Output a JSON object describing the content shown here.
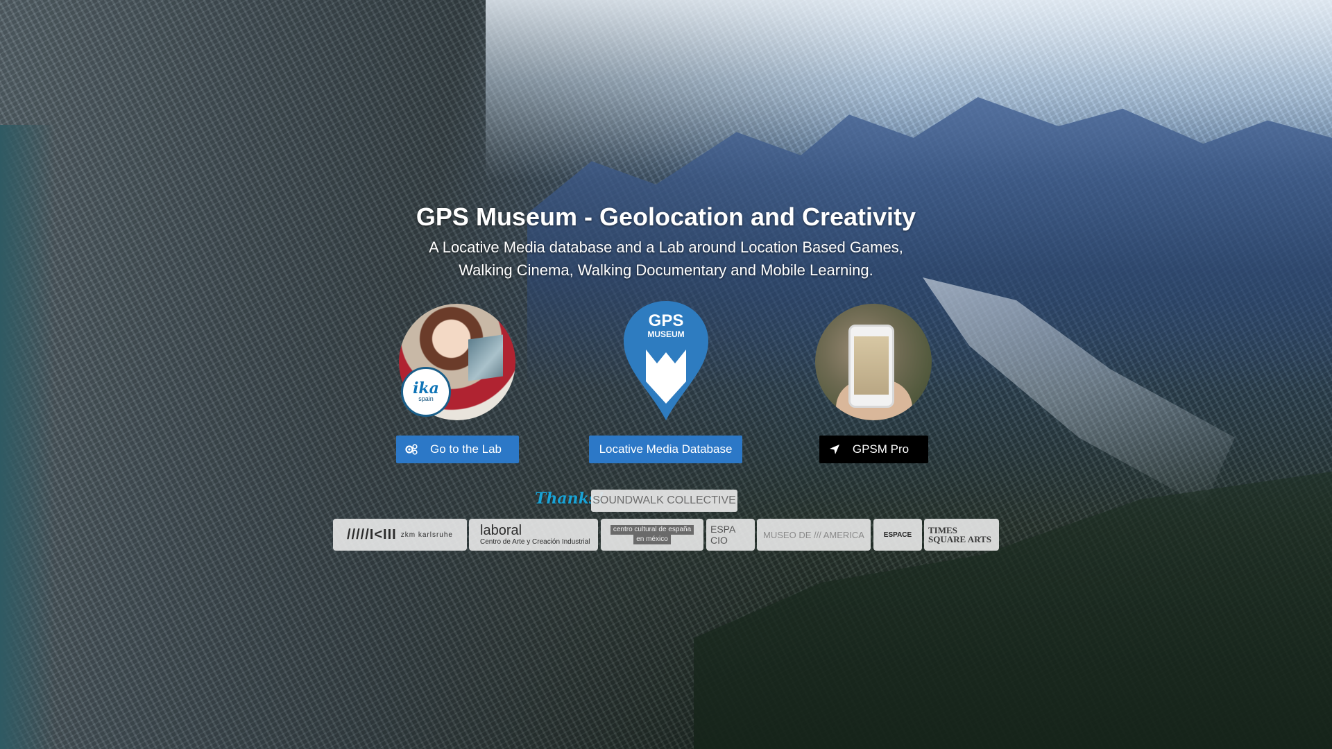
{
  "hero": {
    "title": "GPS Museum - Geolocation and Creativity",
    "subtitle_line1": "A Locative Media database and a Lab around Location Based Games,",
    "subtitle_line2": "Walking Cinema, Walking Documentary and Mobile Learning."
  },
  "cards": {
    "lab": {
      "badge_word": "ika",
      "badge_sub": "spain",
      "button_label": "Go to the Lab",
      "button_icon": "gears-icon"
    },
    "database": {
      "logo_text_line1": "GPS",
      "logo_text_line2": "MUSEUM",
      "button_label": "Locative Media Database"
    },
    "pro": {
      "button_label": "GPSM Pro",
      "button_icon": "location-arrow-icon"
    }
  },
  "partners": {
    "thanks_label": "Thanks!",
    "soundwalk_label": "SOUNDWALK COLLECTIVE",
    "zkm_main": "/////I<III",
    "zkm_sub": "zkm karlsruhe",
    "laboral_main": "laboral",
    "laboral_sub": "Centro de Arte y Creación Industrial",
    "ccemx_line1": "centro cultural de españa",
    "ccemx_line2": "en méxico",
    "espacio": "ESPA CIO",
    "museo": "MUSEO DE /// AMERICA",
    "espace": "ESPACE",
    "tsa": "TIMES SQUARE ARTS"
  },
  "colors": {
    "button_blue": "#2c78c7",
    "button_black": "#000000",
    "pin_blue": "#2e7cc0",
    "thanks_blue": "#19a3d6"
  }
}
